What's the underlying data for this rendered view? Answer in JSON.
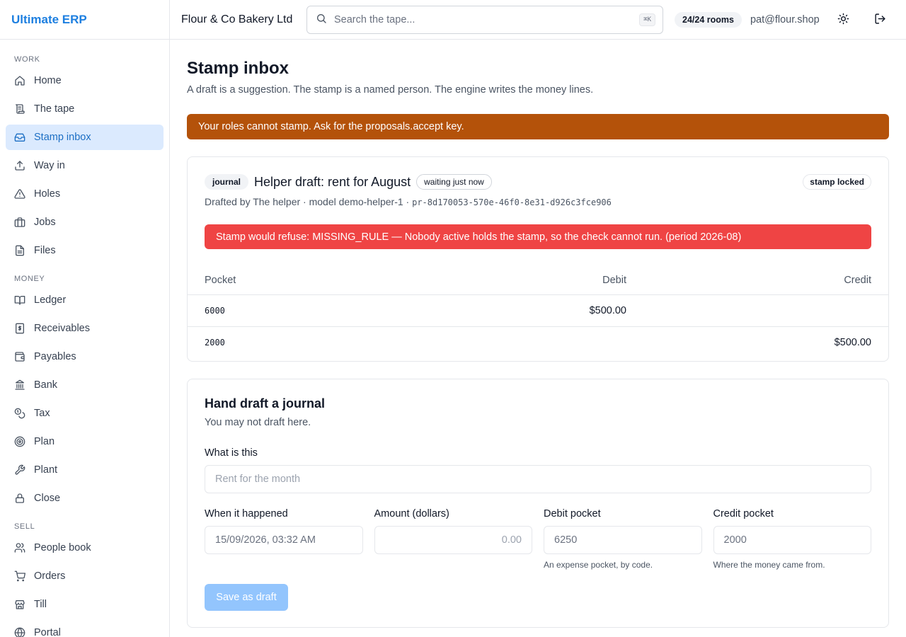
{
  "app": {
    "name": "Ultimate ERP"
  },
  "sidebar": {
    "sections": [
      {
        "title": "WORK",
        "items": [
          {
            "label": "Home",
            "icon": "home-icon"
          },
          {
            "label": "The tape",
            "icon": "scroll-icon"
          },
          {
            "label": "Stamp inbox",
            "icon": "inbox-icon",
            "active": true
          },
          {
            "label": "Way in",
            "icon": "upload-icon"
          },
          {
            "label": "Holes",
            "icon": "warning-icon"
          },
          {
            "label": "Jobs",
            "icon": "briefcase-icon"
          },
          {
            "label": "Files",
            "icon": "file-icon"
          }
        ]
      },
      {
        "title": "MONEY",
        "items": [
          {
            "label": "Ledger",
            "icon": "book-icon"
          },
          {
            "label": "Receivables",
            "icon": "receipt-icon"
          },
          {
            "label": "Payables",
            "icon": "wallet-icon"
          },
          {
            "label": "Bank",
            "icon": "bank-icon"
          },
          {
            "label": "Tax",
            "icon": "coins-icon"
          },
          {
            "label": "Plan",
            "icon": "target-icon"
          },
          {
            "label": "Plant",
            "icon": "wrench-icon"
          },
          {
            "label": "Close",
            "icon": "lock-icon"
          }
        ]
      },
      {
        "title": "SELL",
        "items": [
          {
            "label": "People book",
            "icon": "users-icon"
          },
          {
            "label": "Orders",
            "icon": "cart-icon"
          },
          {
            "label": "Till",
            "icon": "store-icon"
          },
          {
            "label": "Portal",
            "icon": "globe-icon"
          }
        ]
      }
    ]
  },
  "header": {
    "org": "Flour & Co Bakery Ltd",
    "search_placeholder": "Search the tape...",
    "shortcut": "⌘K",
    "rooms": "24/24 rooms",
    "user": "pat@flour.shop"
  },
  "page": {
    "title": "Stamp inbox",
    "subtitle": "A draft is a suggestion. The stamp is a named person. The engine writes the money lines.",
    "warning": "Your roles cannot stamp. Ask for the proposals.accept key."
  },
  "draft": {
    "kind": "journal",
    "title": "Helper draft: rent for August",
    "status": "waiting just now",
    "lock": "stamp locked",
    "meta": "Drafted by The helper · model demo-helper-1 ·",
    "ref": "pr-8d170053-570e-46f0-8e31-d926c3fce906",
    "error": "Stamp would refuse: MISSING_RULE — Nobody active holds the stamp, so the check cannot run. (period 2026-08)",
    "columns": {
      "pocket": "Pocket",
      "debit": "Debit",
      "credit": "Credit"
    },
    "lines": [
      {
        "pocket": "6000",
        "debit": "$500.00",
        "credit": ""
      },
      {
        "pocket": "2000",
        "debit": "",
        "credit": "$500.00"
      }
    ]
  },
  "hand_draft": {
    "title": "Hand draft a journal",
    "subtitle": "You may not draft here.",
    "what_label": "What is this",
    "what_placeholder": "Rent for the month",
    "when_label": "When it happened",
    "when_value": "15/09/2026, 03:32 AM",
    "amount_label": "Amount (dollars)",
    "amount_placeholder": "0.00",
    "debit_label": "Debit pocket",
    "debit_value": "6250",
    "debit_hint": "An expense pocket, by code.",
    "credit_label": "Credit pocket",
    "credit_value": "2000",
    "credit_hint": "Where the money came from.",
    "save_label": "Save as draft"
  },
  "colors": {
    "brand": "#1d7fe0",
    "active_bg": "#dbeafe",
    "warning": "#b4520a",
    "error": "#ef4444",
    "button_disabled": "#93c5fd"
  }
}
